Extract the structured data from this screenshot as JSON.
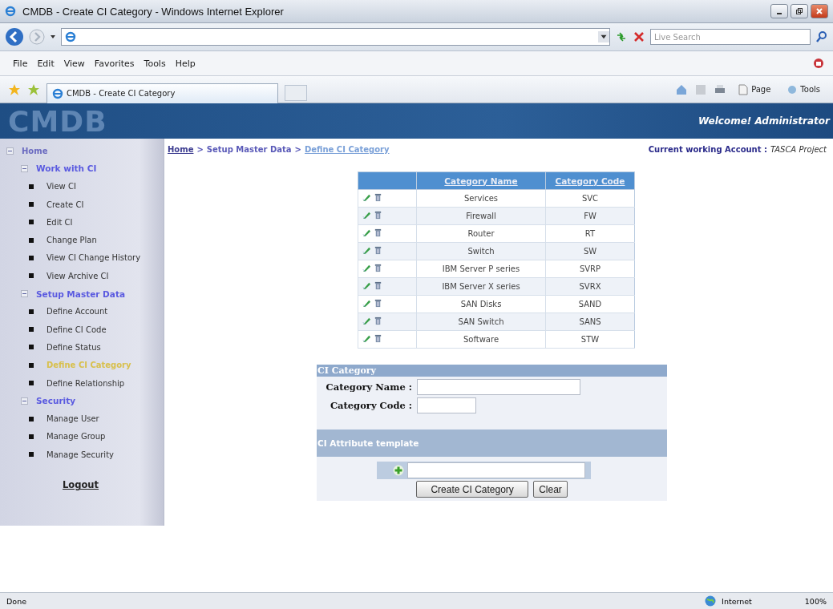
{
  "window": {
    "title": "CMDB - Create CI Category - Windows Internet Explorer"
  },
  "address_bar": {
    "search_placeholder": "Live Search"
  },
  "menu": [
    "File",
    "Edit",
    "View",
    "Favorites",
    "Tools",
    "Help"
  ],
  "tab": {
    "title": "CMDB - Create CI Category"
  },
  "command_bar": [
    "Page",
    "Tools"
  ],
  "banner": {
    "logo": "CMDB",
    "welcome": "Welcome! Administrator"
  },
  "sidebar": {
    "items": [
      {
        "label": "Home",
        "expanded": true,
        "children": [
          {
            "label": "Work with CI",
            "expanded": true,
            "children": [
              {
                "label": "View CI",
                "selected": false
              },
              {
                "label": "Create CI",
                "selected": false
              },
              {
                "label": "Edit CI",
                "selected": false
              },
              {
                "label": "Change Plan",
                "selected": false
              },
              {
                "label": "View CI Change History",
                "selected": false
              },
              {
                "label": "View Archive CI",
                "selected": false
              }
            ]
          },
          {
            "label": "Setup Master Data",
            "expanded": true,
            "children": [
              {
                "label": "Define Account",
                "selected": false
              },
              {
                "label": "Define CI Code",
                "selected": false
              },
              {
                "label": "Define Status",
                "selected": false
              },
              {
                "label": "Define CI Category",
                "selected": true
              },
              {
                "label": "Define Relationship",
                "selected": false
              }
            ]
          },
          {
            "label": "Security",
            "expanded": true,
            "children": [
              {
                "label": "Manage User",
                "selected": false
              },
              {
                "label": "Manage Group",
                "selected": false
              },
              {
                "label": "Manage Security",
                "selected": false
              }
            ]
          }
        ]
      }
    ],
    "logout": "Logout"
  },
  "breadcrumb": {
    "separator": ">",
    "items": [
      {
        "label": "Home",
        "kind": "link"
      },
      {
        "label": "Setup Master Data",
        "kind": "section"
      },
      {
        "label": "Define CI Category",
        "kind": "current"
      }
    ]
  },
  "account": {
    "label": "Current working Account :",
    "value": "TASCA Project"
  },
  "table": {
    "columns": [
      "Category Name",
      "Category Code"
    ],
    "rows": [
      {
        "name": "Services",
        "code": "SVC"
      },
      {
        "name": "Firewall",
        "code": "FW"
      },
      {
        "name": "Router",
        "code": "RT"
      },
      {
        "name": "Switch",
        "code": "SW"
      },
      {
        "name": "IBM Server P series",
        "code": "SVRP"
      },
      {
        "name": "IBM Server X series",
        "code": "SVRX"
      },
      {
        "name": "SAN Disks",
        "code": "SAND"
      },
      {
        "name": "SAN Switch",
        "code": "SANS"
      },
      {
        "name": "Software",
        "code": "STW"
      }
    ]
  },
  "form": {
    "title": "CI Category",
    "fields": [
      {
        "label": "Category Name :",
        "kind": "wide"
      },
      {
        "label": "Category Code :",
        "kind": "short"
      }
    ],
    "template_title": "CI Attribute template",
    "buttons": [
      "Create CI Category",
      "Clear"
    ]
  },
  "status_bar": {
    "text": "Done",
    "zone": "Internet",
    "zoom": "100%"
  }
}
